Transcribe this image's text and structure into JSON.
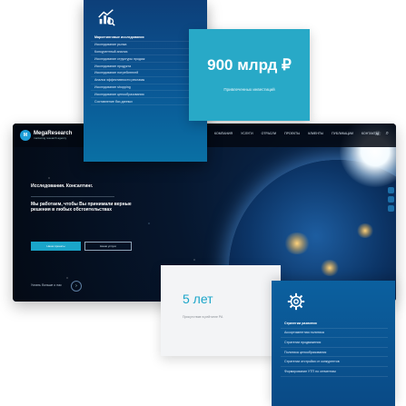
{
  "site": {
    "logo_mark": "M",
    "logo_name": "MegaResearch",
    "logo_tagline": "marketing research agency",
    "nav": [
      "Компания",
      "Услуги",
      "Отрасли",
      "Проекты",
      "Клиенты",
      "Публикации",
      "Контакты"
    ],
    "hero_title": "Исследования. Консалтинг.",
    "hero_text": "Мы работаем, чтобы Вы принимали верные решения в любых обстоятельствах",
    "btn_primary": "Наши проекты",
    "btn_secondary": "Наши услуги",
    "more_label": "Узнать больше о нас",
    "more_arrow": "›"
  },
  "menu": {
    "icon": "analytics-icon",
    "items": [
      "Маркетинговые исследования",
      "Исследование рынка",
      "Конкурентный анализ",
      "Исследование структуры продаж",
      "Исследование продукта",
      "Исследование потребителей",
      "Анализ эффективности рекламы",
      "Исследование shopping",
      "Исследование ценообразования",
      "Составление баз данных"
    ]
  },
  "stat_900": {
    "value": "900 млрд ₽",
    "label": "Привлеченных инвестиций"
  },
  "stat_5": {
    "value": "5 лет",
    "label": "Присутствие в рейтинге РА"
  },
  "strategies": {
    "icon": "gear-icon",
    "items": [
      "Стратегии развития",
      "Ассортиментная политика",
      "Стратегии продвижения",
      "Политика ценообразования",
      "Стратегии отстройки от конкурентов",
      "Формирование УТП по сегментам"
    ]
  },
  "colors": {
    "accent": "#1aa5c9",
    "menu_blue": "#0a5896",
    "dark_bg": "#07101c"
  }
}
